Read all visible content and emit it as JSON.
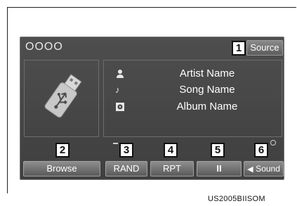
{
  "header": {
    "status_text": "OOOO",
    "source_label": "Source"
  },
  "track": {
    "artist": "Artist Name",
    "song": "Song Name",
    "album": "Album Name"
  },
  "controls": {
    "browse": "Browse",
    "rand": "RAND",
    "rpt": "RPT",
    "pause": "II",
    "sound": "Sound"
  },
  "callouts": [
    "1",
    "2",
    "3",
    "4",
    "5",
    "6"
  ],
  "footer_code": "US2005BIISOM",
  "icons": {
    "media": "usb-drive-icon",
    "artist": "person-icon",
    "song": "music-note-icon",
    "album": "disc-icon",
    "sound": "speaker-icon"
  },
  "colors": {
    "screen_bg": "#464646",
    "button_top": "#8d8d8d",
    "button_bottom": "#5a5a5a",
    "text": "#ffffff"
  }
}
